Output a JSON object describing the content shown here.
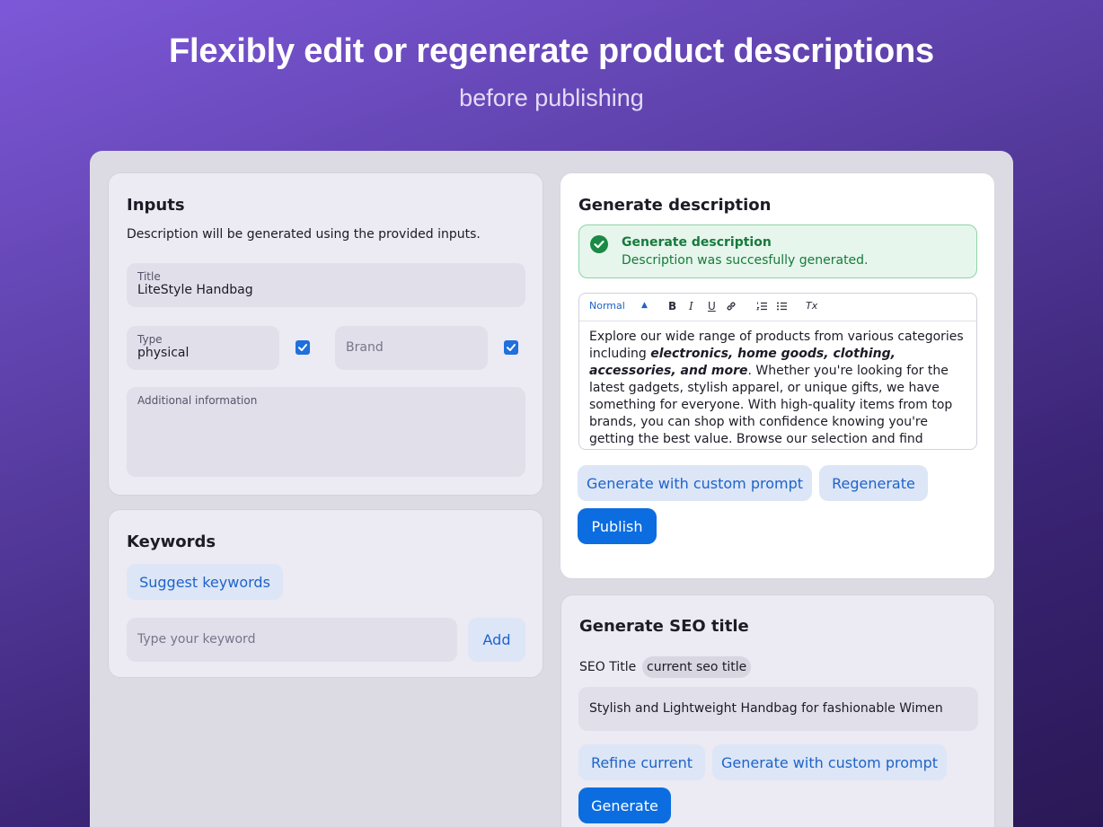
{
  "hero": {
    "title": "Flexibly edit or regenerate product descriptions",
    "subtitle": "before publishing"
  },
  "inputs": {
    "title": "Inputs",
    "description": "Description will be generated using the provided inputs.",
    "title_field": {
      "label": "Title",
      "value": "LiteStyle Handbag"
    },
    "type_field": {
      "label": "Type",
      "value": "physical",
      "checked": true
    },
    "brand_field": {
      "placeholder": "Brand",
      "checked": true
    },
    "additional_field": {
      "label": "Additional information"
    }
  },
  "keywords": {
    "title": "Keywords",
    "suggest_label": "Suggest keywords",
    "input_placeholder": "Type your keyword",
    "add_label": "Add"
  },
  "generate_description": {
    "title": "Generate description",
    "alert": {
      "title": "Generate description",
      "message": "Description was succesfully generated.",
      "icon": "check-circle-icon",
      "color": "#1a8a44"
    },
    "toolbar": {
      "format_select": "Normal",
      "bold_label": "B",
      "italic_label": "I",
      "underline_label": "U",
      "clear_label": "Tx"
    },
    "body": {
      "intro": "Explore our wide range of products from various categories including ",
      "emphasis": "electronics, home goods, clothing, accessories, and more",
      "rest": ". Whether you're looking for the latest gadgets, stylish apparel, or unique gifts, we have something for everyone. With high-quality items from top brands, you can shop with confidence knowing you're getting the best value. Browse our selection and find exactly what you need to enhance your"
    },
    "custom_prompt_label": "Generate with custom prompt",
    "regenerate_label": "Regenerate",
    "publish_label": "Publish"
  },
  "seo": {
    "title": "Generate SEO title",
    "label": "SEO Title",
    "badge": "current seo title",
    "value": "Stylish and Lightweight Handbag for fashionable Wimen",
    "refine_label": "Refine current",
    "custom_prompt_label": "Generate with custom prompt",
    "generate_label": "Generate"
  },
  "colors": {
    "primary": "#0b6de0",
    "soft_button": "#dce6f7",
    "success": "#1a8a44"
  }
}
